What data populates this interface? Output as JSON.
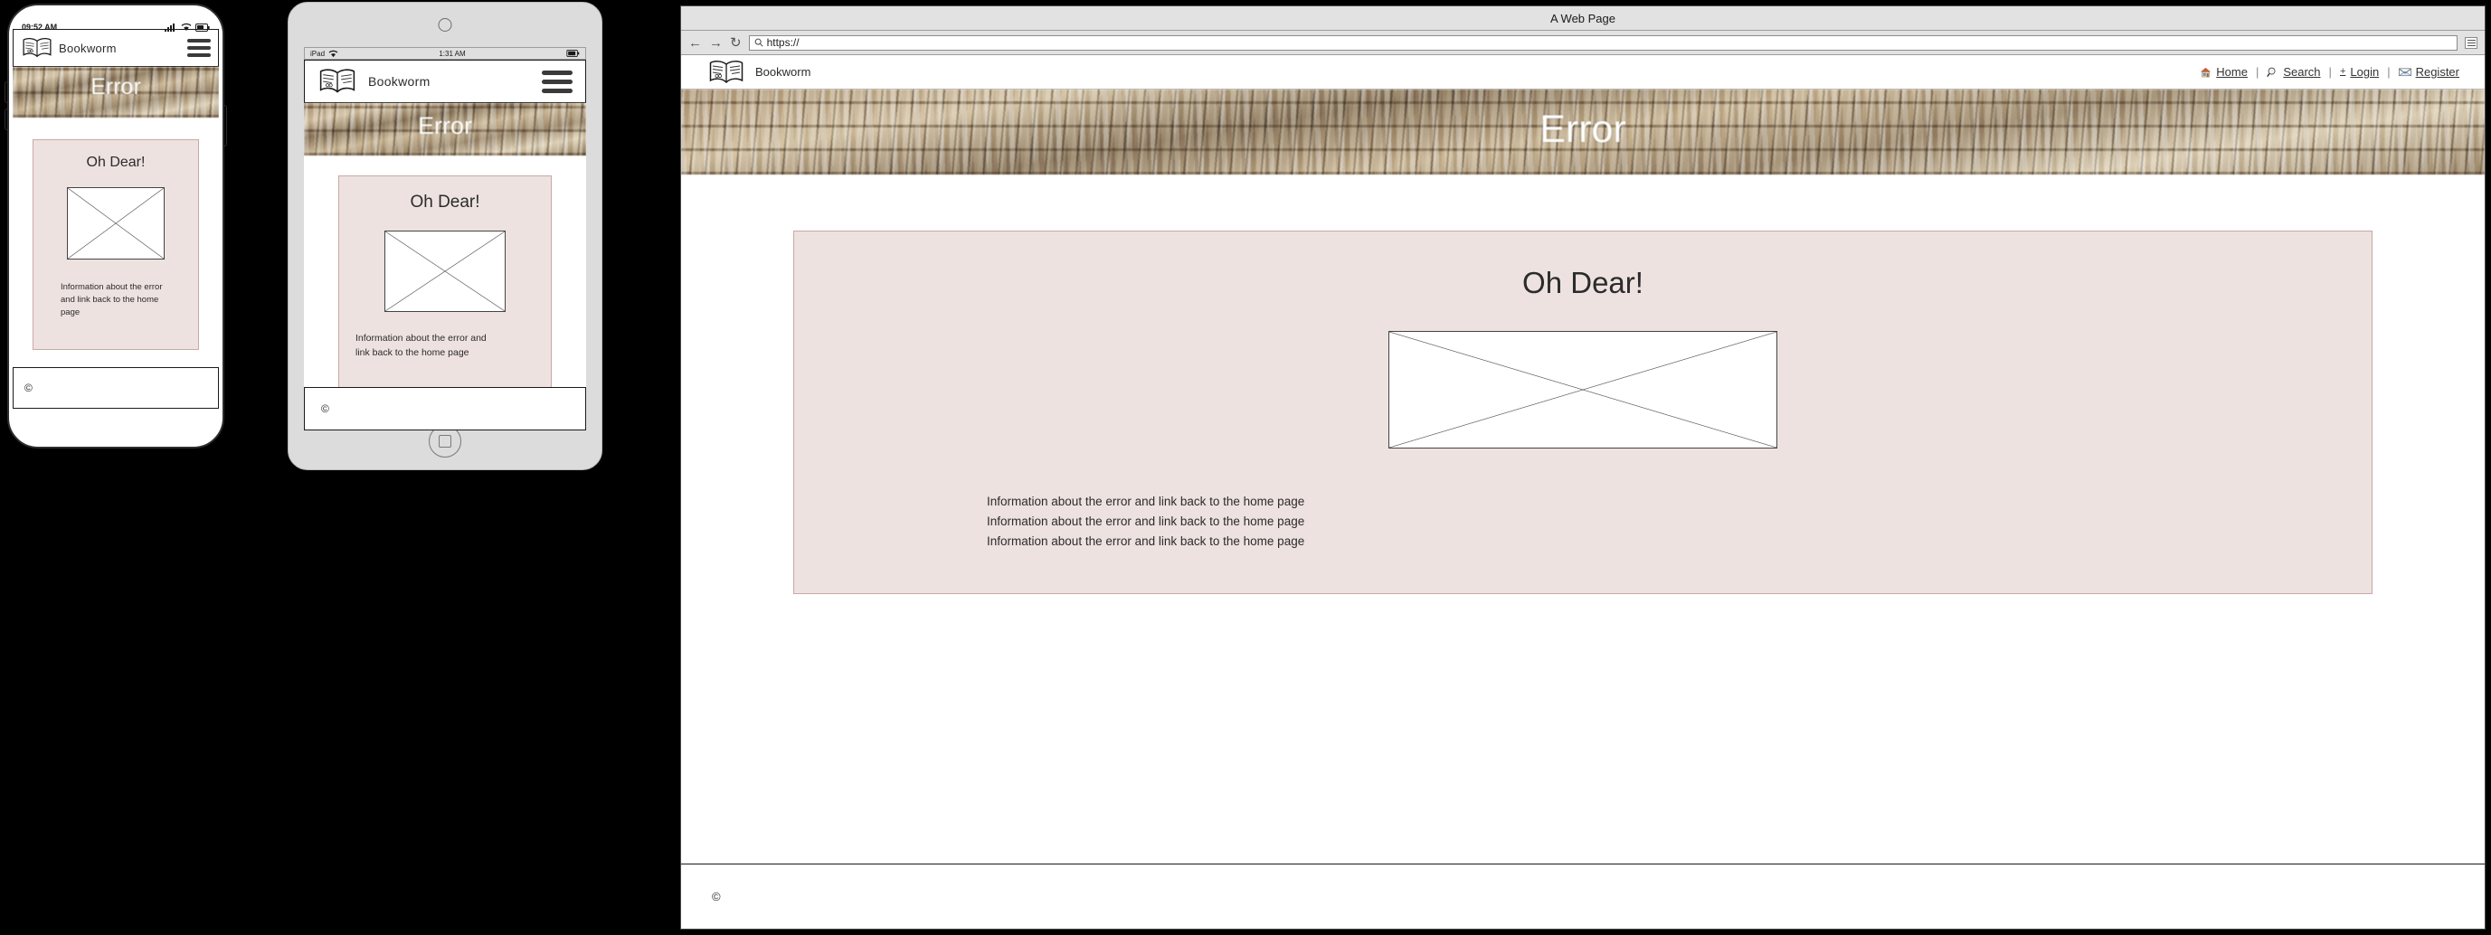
{
  "brand": {
    "name": "Bookworm",
    "logo_icon": "open-book-icon"
  },
  "hero": {
    "title": "Error"
  },
  "card": {
    "title": "Oh Dear!",
    "image_placeholder": "image-placeholder-icon",
    "body_phone": "Information about the error and link back to the home page",
    "body_tablet": "Information about the error and link back to the home page",
    "body_web_lines": [
      "Information about the error and link back to the home page",
      "Information about the error and link back to the home page",
      "Information about the error and link back to the home page"
    ]
  },
  "footer": {
    "copyright": "©"
  },
  "phone": {
    "status_time": "09:52 AM",
    "signal_icon": "cell-signal-icon",
    "wifi_icon": "wifi-icon",
    "battery_icon": "battery-icon",
    "menu_icon": "hamburger-menu-icon"
  },
  "tablet": {
    "status_device": "iPad",
    "status_time": "1:31 AM",
    "wifi_icon": "wifi-icon",
    "battery_icon": "battery-icon",
    "menu_icon": "hamburger-menu-icon",
    "home_button": "home-button"
  },
  "browser": {
    "window_title": "A Web Page",
    "back_icon": "back-arrow-icon",
    "forward_icon": "forward-arrow-icon",
    "reload_icon": "reload-icon",
    "search_icon": "search-icon",
    "url_value": "https://",
    "url_placeholder": "https://",
    "menu_icon": "browser-menu-icon",
    "nav": [
      {
        "label": "Home",
        "icon": "house-icon"
      },
      {
        "label": "Search",
        "icon": "magnifier-icon"
      },
      {
        "label": "Login",
        "icon": "plus-icon"
      },
      {
        "label": "Register",
        "icon": "envelope-icon"
      }
    ],
    "nav_separator": "|"
  },
  "colors": {
    "card_bg": "#ede2e0",
    "card_border": "#c9a9a5",
    "hero_text": "#ffffff",
    "ink": "#2b2b2b"
  }
}
